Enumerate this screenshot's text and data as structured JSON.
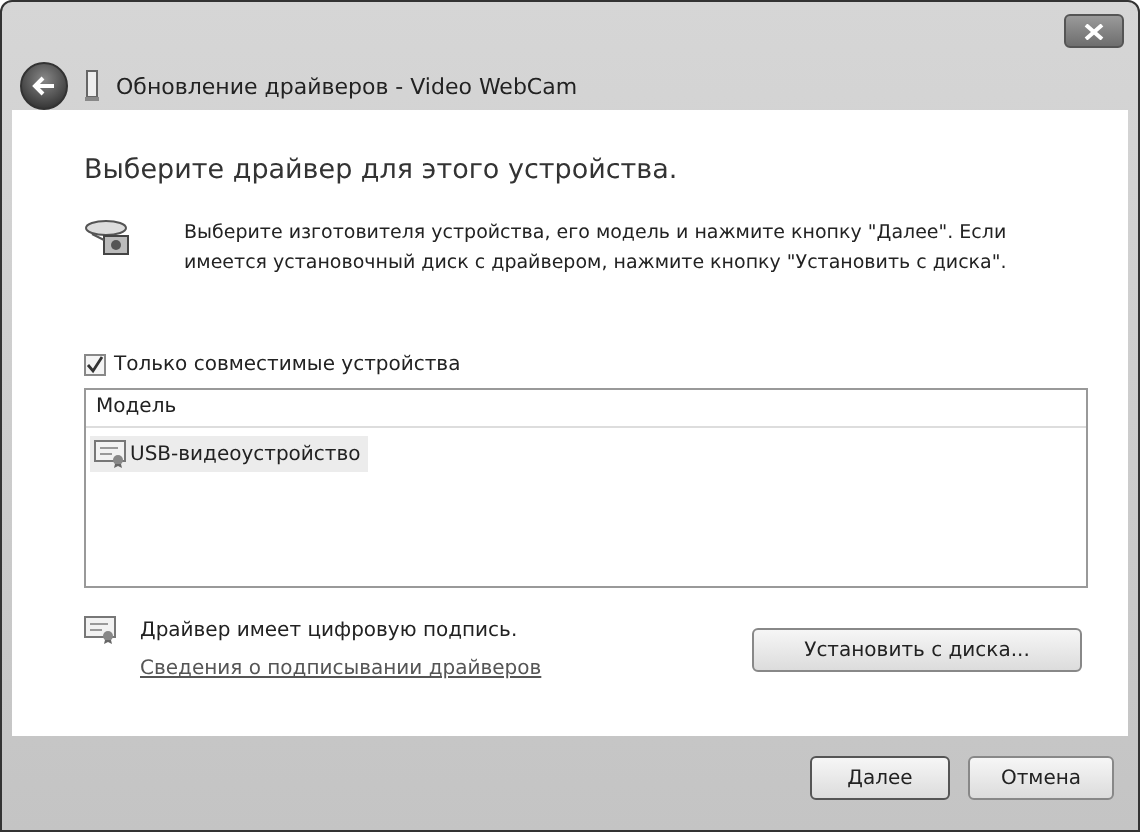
{
  "window": {
    "title": "Обновление драйверов - Video WebCam"
  },
  "heading": "Выберите драйвер для этого устройства.",
  "description": "Выберите изготовителя устройства, его модель и нажмите кнопку \"Далее\". Если имеется установочный диск с  драйвером, нажмите кнопку \"Установить с диска\".",
  "compatible_checkbox": {
    "label": "Только совместимые устройства",
    "checked": true
  },
  "model_list": {
    "column": "Модель",
    "rows": [
      {
        "label": "USB-видеоустройство",
        "selected": true
      }
    ]
  },
  "signature": {
    "text": "Драйвер имеет цифровую подпись.",
    "link": "Сведения о подписывании драйверов"
  },
  "install_button": "Установить с диска...",
  "buttons": [
    {
      "label": "Далее",
      "default": true
    },
    {
      "label": "Отмена",
      "default": false
    }
  ]
}
